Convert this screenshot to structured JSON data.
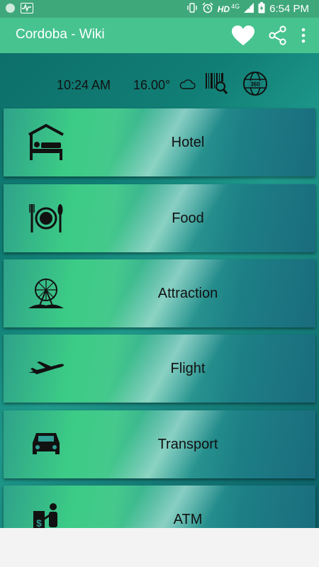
{
  "status_bar": {
    "network": "HD",
    "network_sub": "4G",
    "time": "6:54 PM"
  },
  "app_bar": {
    "title": "Cordoba - Wiki",
    "actions": [
      "heart-icon",
      "share-icon",
      "more-vert-icon"
    ]
  },
  "info_bar": {
    "time": "10:24 AM",
    "temperature": "16.00°",
    "icons": [
      "cloud-icon",
      "barcode-scan-icon",
      "globe-360-icon"
    ]
  },
  "menu": {
    "items": [
      {
        "label": "Hotel",
        "icon": "hotel-bed-icon"
      },
      {
        "label": "Food",
        "icon": "plate-cutlery-icon"
      },
      {
        "label": "Attraction",
        "icon": "ferris-wheel-icon"
      },
      {
        "label": "Flight",
        "icon": "airplane-icon"
      },
      {
        "label": "Transport",
        "icon": "car-icon"
      },
      {
        "label": "ATM",
        "icon": "atm-icon"
      }
    ]
  }
}
